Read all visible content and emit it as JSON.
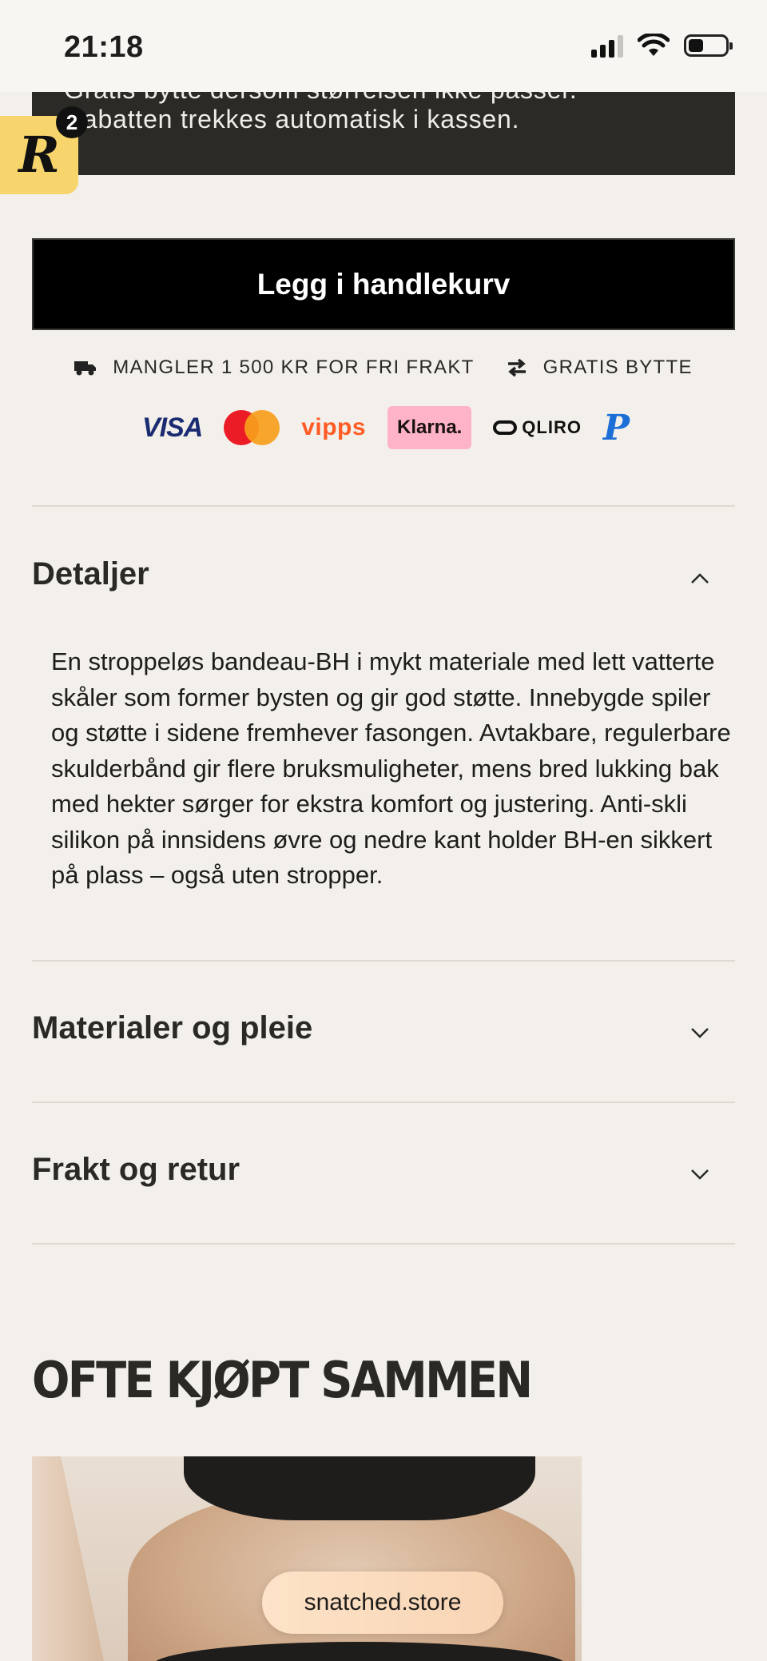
{
  "status_bar": {
    "time": "21:18"
  },
  "notice": {
    "line1": "Gratis bytte dersom størrelsen ikke passer.",
    "line2": "Rabatten trekkes automatisk i kassen."
  },
  "rewards": {
    "letter": "R",
    "count": "2"
  },
  "cart_button": {
    "label": "Legg i handlekurv"
  },
  "shipping": {
    "free_shipping_text": "MANGLER 1 500 KR FOR FRI FRAKT",
    "exchange_text": "GRATIS BYTTE"
  },
  "payments": {
    "visa": "VISA",
    "vipps": "vipps",
    "klarna": "Klarna.",
    "qliro": "QLIRO",
    "paypal": "P"
  },
  "accordion": {
    "details": {
      "title": "Detaljer",
      "expanded": true,
      "text": "En stroppeløs bandeau-BH i mykt materiale med lett vatterte skåler som former bysten og gir god støtte. Innebygde spiler og støtte i sidene fremhever fasongen. Avtakbare, regulerbare skulderbånd gir flere bruksmuligheter, mens bred lukking bak med hekter sørger for ekstra komfort og justering. Anti-skli silikon på innsidens øvre og nedre kant holder BH-en sikkert på plass – også uten stropper."
    },
    "materials": {
      "title": "Materialer og pleie",
      "expanded": false
    },
    "shipping_returns": {
      "title": "Frakt og retur",
      "expanded": false
    }
  },
  "related": {
    "title": "OFTE KJØPT SAMMEN"
  },
  "browser": {
    "url": "snatched.store"
  }
}
